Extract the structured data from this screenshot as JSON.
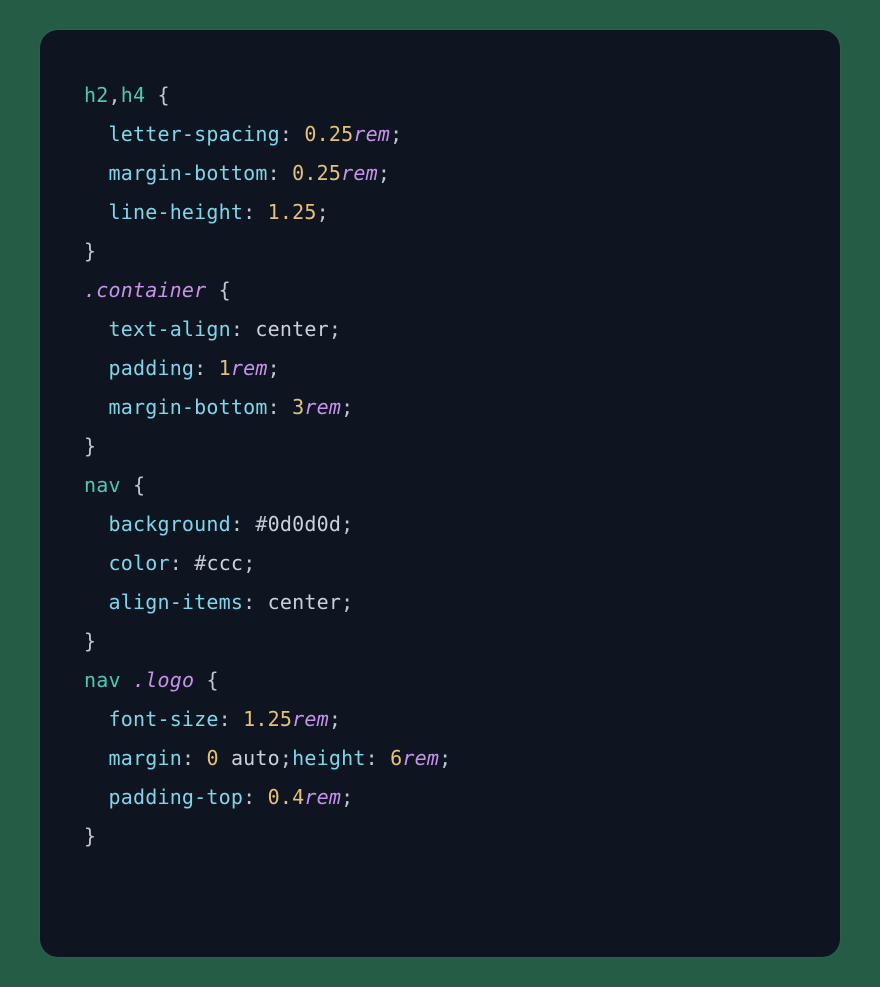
{
  "rules": [
    {
      "selector": [
        {
          "kind": "tag",
          "text": "h2"
        },
        {
          "kind": "punct",
          "text": ","
        },
        {
          "kind": "tag",
          "text": "h4"
        }
      ],
      "decls": [
        {
          "prop": "letter-spacing",
          "value": [
            {
              "kind": "num",
              "text": "0.25"
            },
            {
              "kind": "unit",
              "text": "rem"
            }
          ]
        },
        {
          "prop": "margin-bottom",
          "value": [
            {
              "kind": "num",
              "text": "0.25"
            },
            {
              "kind": "unit",
              "text": "rem"
            }
          ]
        },
        {
          "prop": "line-height",
          "value": [
            {
              "kind": "num",
              "text": "1.25"
            }
          ]
        }
      ]
    },
    {
      "selector": [
        {
          "kind": "class",
          "text": ".container"
        }
      ],
      "decls": [
        {
          "prop": "text-align",
          "value": [
            {
              "kind": "ident",
              "text": "center"
            }
          ]
        },
        {
          "prop": "padding",
          "value": [
            {
              "kind": "num",
              "text": "1"
            },
            {
              "kind": "unit",
              "text": "rem"
            }
          ]
        },
        {
          "prop": "margin-bottom",
          "value": [
            {
              "kind": "num",
              "text": "3"
            },
            {
              "kind": "unit",
              "text": "rem"
            }
          ]
        }
      ]
    },
    {
      "selector": [
        {
          "kind": "tag",
          "text": "nav"
        }
      ],
      "decls": [
        {
          "prop": "background",
          "value": [
            {
              "kind": "hash",
              "text": "#"
            },
            {
              "kind": "hex",
              "text": "0d0d0d"
            }
          ]
        },
        {
          "prop": "color",
          "value": [
            {
              "kind": "hash",
              "text": "#"
            },
            {
              "kind": "hex",
              "text": "ccc"
            }
          ]
        },
        {
          "prop": "align-items",
          "value": [
            {
              "kind": "ident",
              "text": "center"
            }
          ]
        }
      ]
    },
    {
      "selector": [
        {
          "kind": "tag",
          "text": "nav"
        },
        {
          "kind": "space",
          "text": " "
        },
        {
          "kind": "class",
          "text": ".logo"
        }
      ],
      "decls": [
        {
          "prop": "font-size",
          "value": [
            {
              "kind": "num",
              "text": "1.25"
            },
            {
              "kind": "unit",
              "text": "rem"
            }
          ]
        },
        {
          "prop": "margin",
          "value": [
            {
              "kind": "num",
              "text": "0"
            },
            {
              "kind": "space",
              "text": " "
            },
            {
              "kind": "ident",
              "text": "auto"
            }
          ],
          "inline_next": true
        },
        {
          "prop": "height",
          "value": [
            {
              "kind": "num",
              "text": "6"
            },
            {
              "kind": "unit",
              "text": "rem"
            }
          ]
        },
        {
          "prop": "padding-top",
          "value": [
            {
              "kind": "num",
              "text": "0.4"
            },
            {
              "kind": "unit",
              "text": "rem"
            }
          ]
        }
      ]
    }
  ]
}
